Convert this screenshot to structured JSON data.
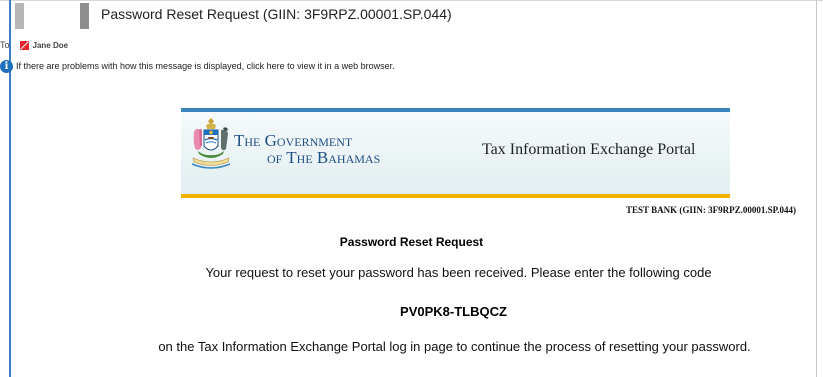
{
  "message": {
    "subject": "Password Reset Request (GIIN: 3F9RPZ.00001.SP.044)",
    "to_label": "To",
    "recipient": "Jane Doe",
    "info_bar": "If there are problems with how this message is displayed, click here to view it in a web browser."
  },
  "banner": {
    "gov_line1": "The Government",
    "gov_line2": "of The Bahamas",
    "portal_title": "Tax Information Exchange Portal"
  },
  "email": {
    "bank_line": "TEST BANK (GIIN: 3F9RPZ.00001.SP.044)",
    "heading": "Password Reset Request",
    "body_line1": "Your request to reset your password has been received. Please enter the following code",
    "code": "PV0PK8-TLBQCZ",
    "body_line2": "on the Tax Information Exchange Portal log in page to continue the process of resetting your password."
  },
  "colors": {
    "accent_blue": "#3a87bd",
    "accent_gold": "#f0b400",
    "gov_blue": "#1f4e83",
    "info_blue": "#1f6fbf",
    "recipient_red": "#e8242b"
  },
  "icons": {
    "info": "info-icon",
    "recipient": "recipient-status-icon",
    "crest": "coat-of-arms-icon"
  }
}
